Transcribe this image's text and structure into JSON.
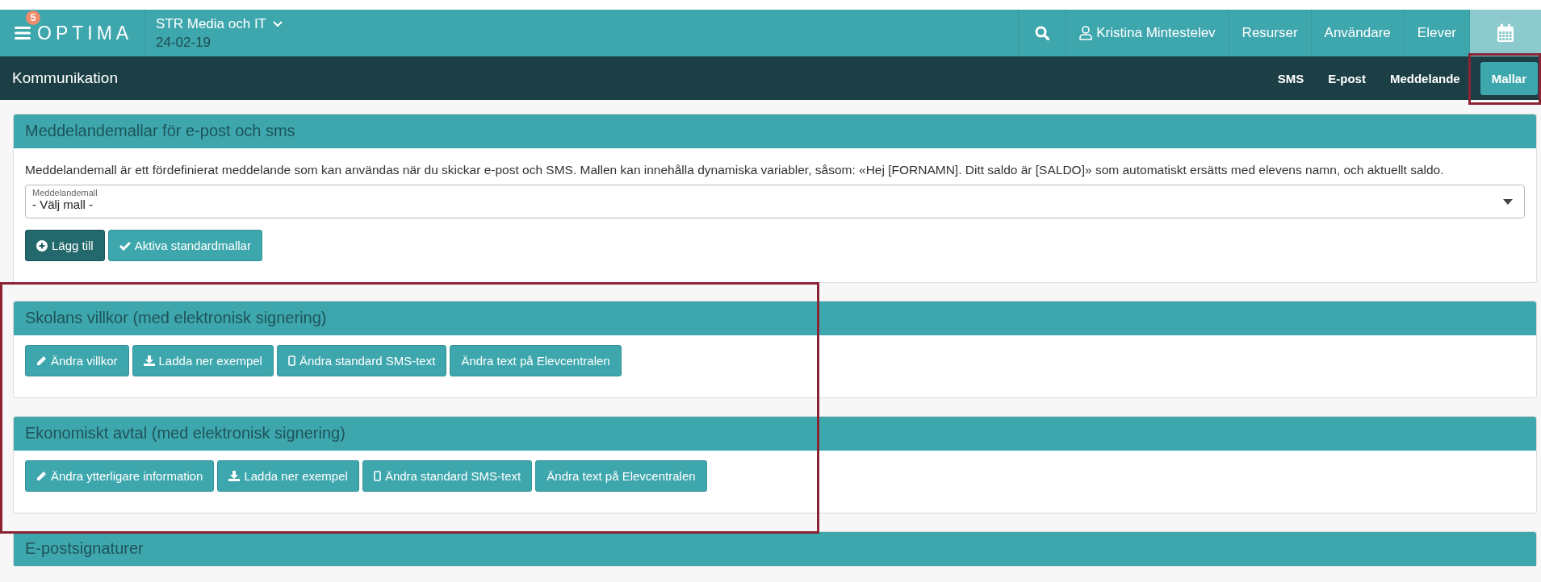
{
  "topbar": {
    "badge": "5",
    "logo": "OPTIMA",
    "organization": "STR Media och IT",
    "date": "24-02-19",
    "user": "Kristina Mintestelev",
    "nav": [
      "Resurser",
      "Användare",
      "Elever"
    ]
  },
  "subbar": {
    "title": "Kommunikation",
    "tabs": [
      {
        "label": "SMS",
        "selected": false
      },
      {
        "label": "E-post",
        "selected": false
      },
      {
        "label": "Meddelande",
        "selected": false
      },
      {
        "label": "Mallar",
        "selected": true
      }
    ]
  },
  "panels": [
    {
      "title": "Meddelandemallar för e-post och sms",
      "description": "Meddelandemall är ett fördefinierat meddelande som kan användas när du skickar e-post och SMS. Mallen kan innehålla dynamiska variabler, såsom: «Hej [FORNAMN]. Ditt saldo är [SALDO]» som automatiskt ersätts med elevens namn, och aktuellt saldo.",
      "select": {
        "label": "Meddelandemall",
        "value": "- Välj mall -"
      },
      "buttons": [
        {
          "label": "Lägg till",
          "kind": "add"
        },
        {
          "label": "Aktiva standardmallar",
          "kind": "check"
        }
      ]
    },
    {
      "title": "Skolans villkor (med elektronisk signering)",
      "buttons": [
        {
          "label": "Ändra villkor",
          "kind": "edit"
        },
        {
          "label": "Ladda ner exempel",
          "kind": "download"
        },
        {
          "label": "Ändra standard SMS-text",
          "kind": "mobile"
        },
        {
          "label": "Ändra text på Elevcentralen",
          "kind": "plain"
        }
      ]
    },
    {
      "title": "Ekonomiskt avtal (med elektronisk signering)",
      "buttons": [
        {
          "label": "Ändra ytterligare information",
          "kind": "edit"
        },
        {
          "label": "Ladda ner exempel",
          "kind": "download"
        },
        {
          "label": "Ändra standard SMS-text",
          "kind": "mobile"
        },
        {
          "label": "Ändra text på Elevcentralen",
          "kind": "plain"
        }
      ]
    },
    {
      "title": "E-postsignaturer"
    }
  ]
}
